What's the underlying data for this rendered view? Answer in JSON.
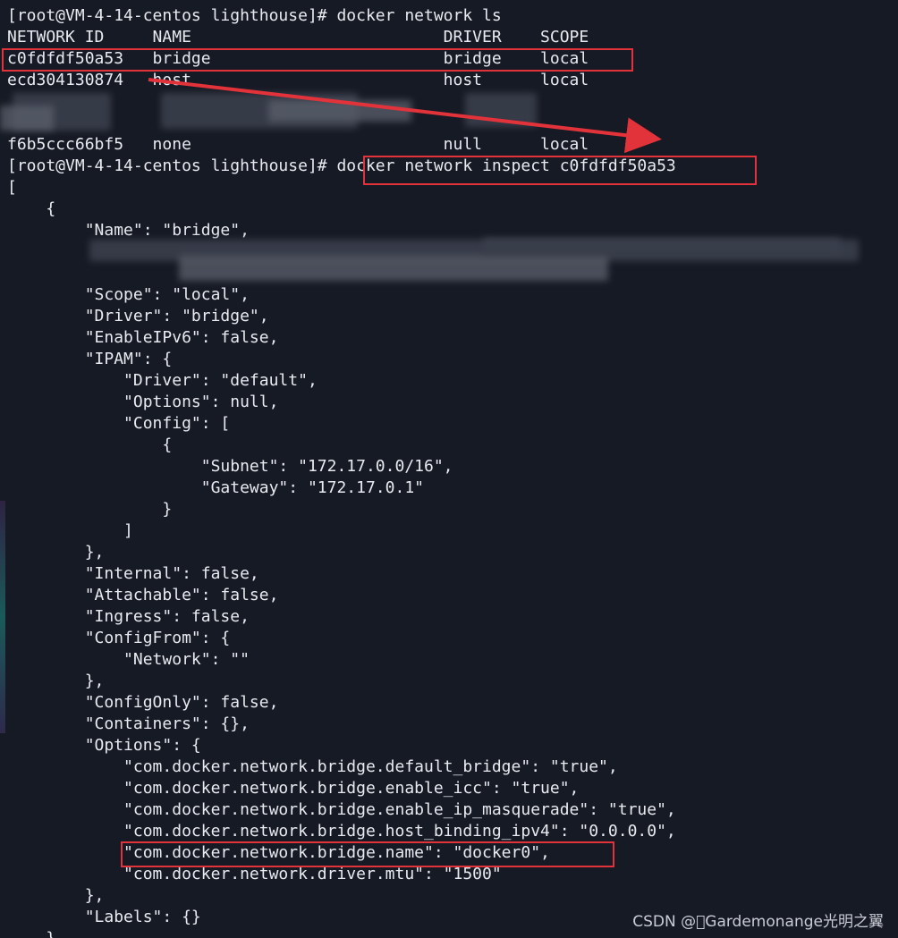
{
  "terminal": {
    "background": "#161a24",
    "foreground": "#e8eaf0",
    "highlight_color": "#e2323a",
    "lines": [
      "[root@VM-4-14-centos lighthouse]# docker network ls",
      "NETWORK ID     NAME                          DRIVER    SCOPE",
      "c0fdfdf50a53   bridge                        bridge    local",
      "ecd304130874   host                          host      local",
      "",
      "",
      "f6b5ccc66bf5   none                          null      local",
      "[root@VM-4-14-centos lighthouse]# docker network inspect c0fdfdf50a53",
      "[",
      "    {",
      "        \"Name\": \"bridge\",",
      "",
      "",
      "        \"Scope\": \"local\",",
      "        \"Driver\": \"bridge\",",
      "        \"EnableIPv6\": false,",
      "        \"IPAM\": {",
      "            \"Driver\": \"default\",",
      "            \"Options\": null,",
      "            \"Config\": [",
      "                {",
      "                    \"Subnet\": \"172.17.0.0/16\",",
      "                    \"Gateway\": \"172.17.0.1\"",
      "                }",
      "            ]",
      "        },",
      "        \"Internal\": false,",
      "        \"Attachable\": false,",
      "        \"Ingress\": false,",
      "        \"ConfigFrom\": {",
      "            \"Network\": \"\"",
      "        },",
      "        \"ConfigOnly\": false,",
      "        \"Containers\": {},",
      "        \"Options\": {",
      "            \"com.docker.network.bridge.default_bridge\": \"true\",",
      "            \"com.docker.network.bridge.enable_icc\": \"true\",",
      "            \"com.docker.network.bridge.enable_ip_masquerade\": \"true\",",
      "            \"com.docker.network.bridge.host_binding_ipv4\": \"0.0.0.0\",",
      "            \"com.docker.network.bridge.name\": \"docker0\",",
      "            \"com.docker.network.driver.mtu\": \"1500\"",
      "        },",
      "        \"Labels\": {}",
      "    }"
    ]
  },
  "watermark": "CSDN @\u0000Gardemonange光明之翼"
}
